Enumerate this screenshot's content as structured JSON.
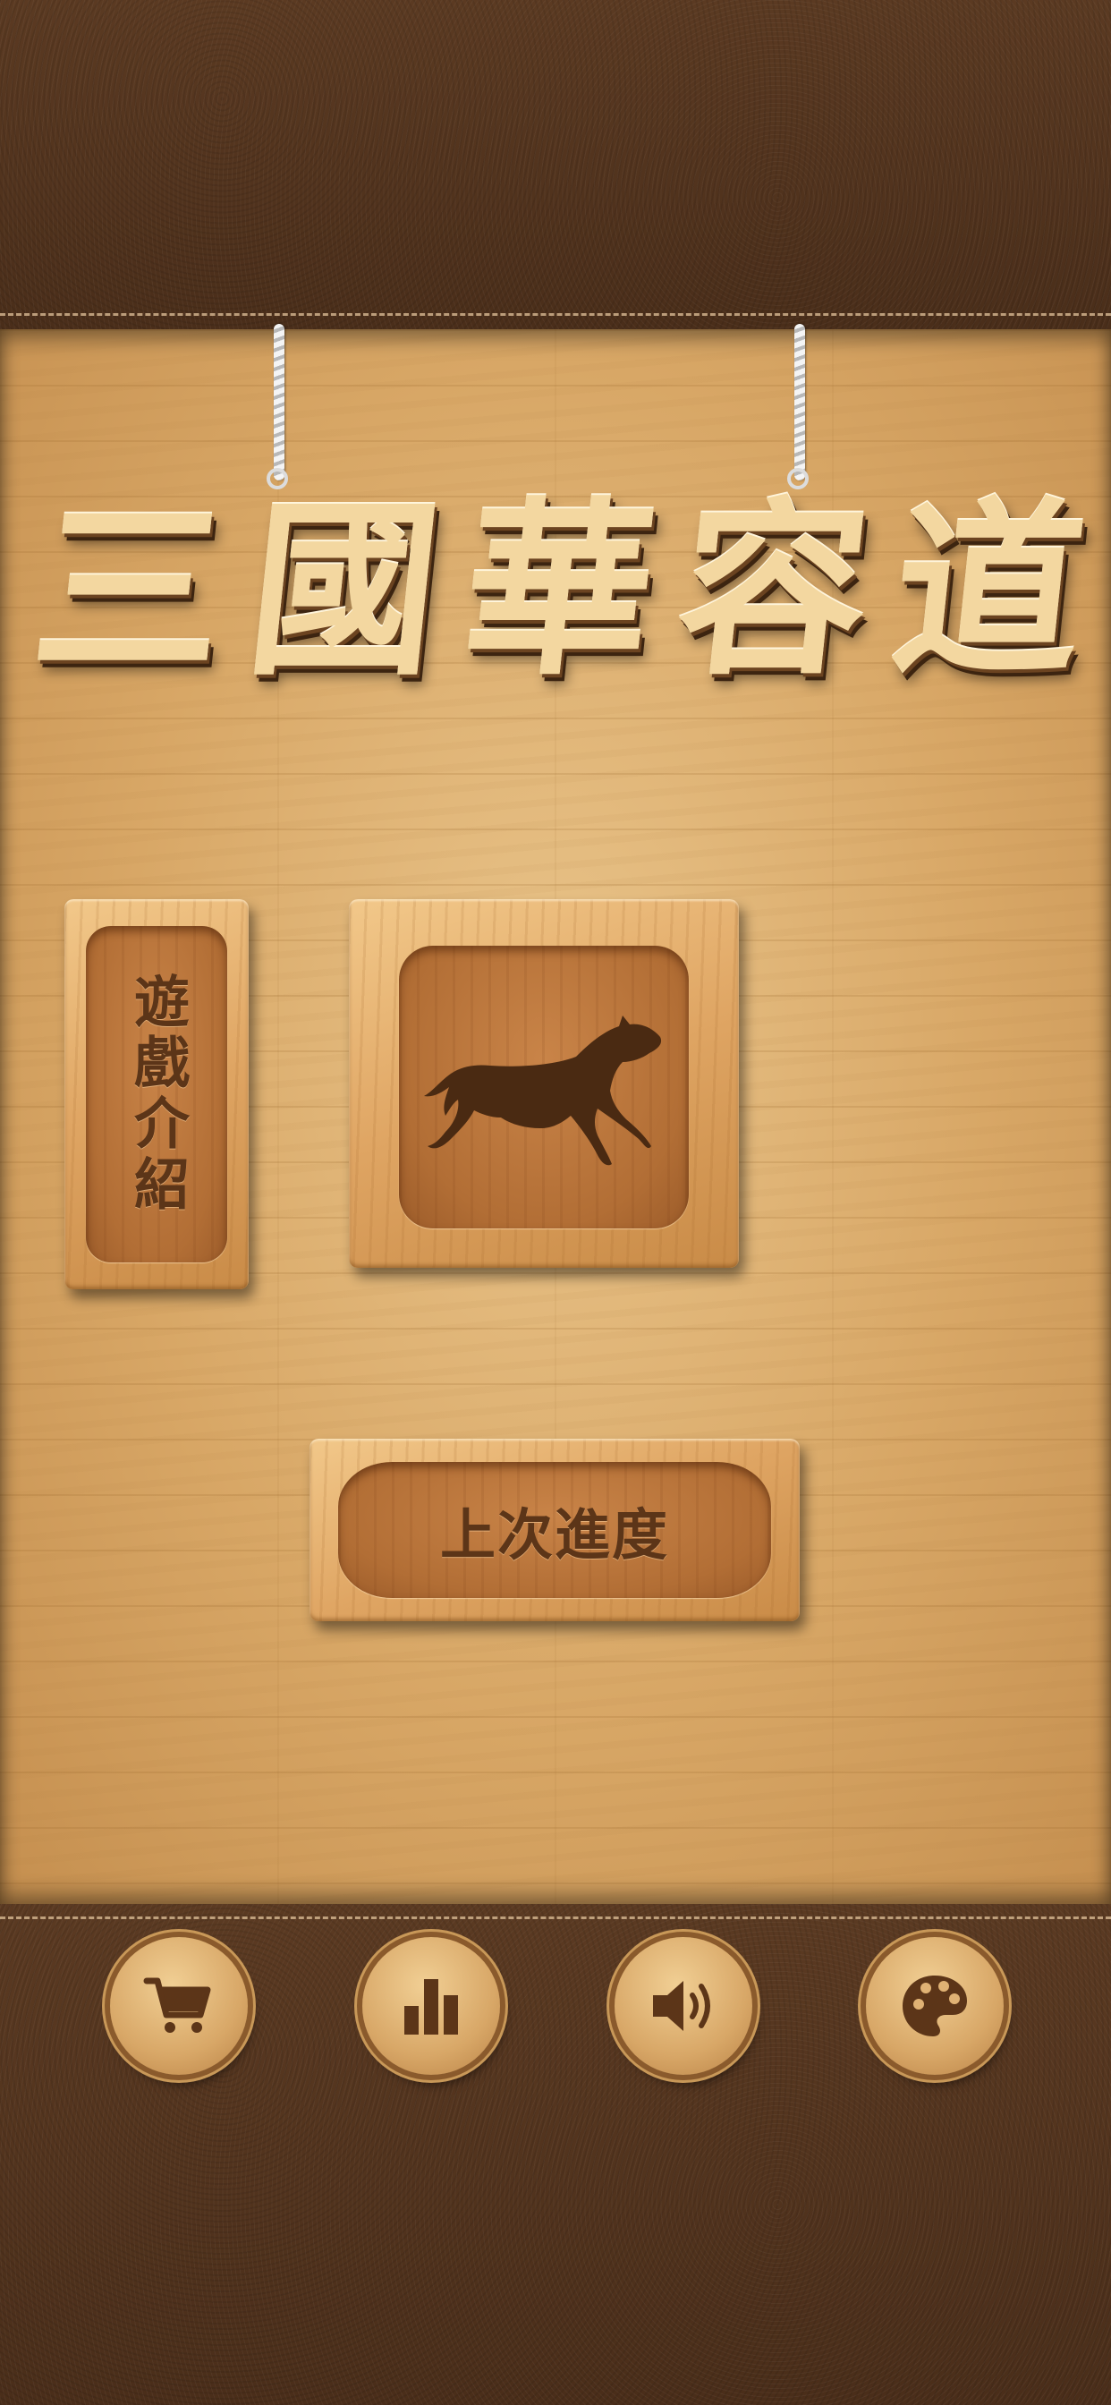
{
  "app": {
    "title_chars": [
      "三",
      "國",
      "華",
      "容",
      "道"
    ]
  },
  "menu": {
    "intro_label": "遊戲介紹",
    "start_icon": "horse-icon",
    "continue_label": "上次進度"
  },
  "toolbar": {
    "icons": [
      "cart-icon",
      "bar-chart-icon",
      "speaker-icon",
      "palette-icon"
    ]
  },
  "colors": {
    "leather": "#5b3a22",
    "wood": "#d8a766",
    "text_brown": "#5c3518"
  }
}
